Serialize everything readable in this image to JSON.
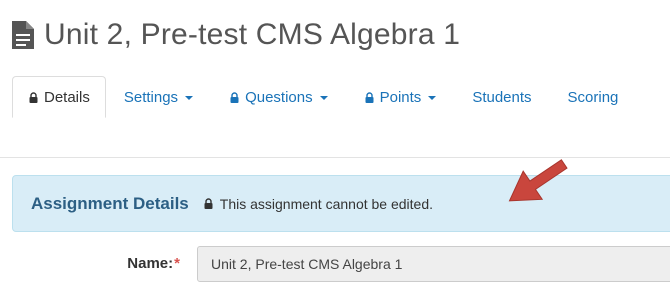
{
  "page": {
    "title": "Unit 2, Pre-test CMS Algebra 1",
    "title_icon": "document-icon"
  },
  "tabs": [
    {
      "label": "Details",
      "icon": "lock-icon",
      "active": true,
      "dropdown": false
    },
    {
      "label": "Settings",
      "icon": null,
      "active": false,
      "dropdown": true
    },
    {
      "label": "Questions",
      "icon": "lock-icon",
      "active": false,
      "dropdown": true
    },
    {
      "label": "Points",
      "icon": "lock-icon",
      "active": false,
      "dropdown": true
    },
    {
      "label": "Students",
      "icon": null,
      "active": false,
      "dropdown": false
    },
    {
      "label": "Scoring",
      "icon": null,
      "active": false,
      "dropdown": false
    }
  ],
  "info_panel": {
    "heading": "Assignment Details",
    "note": "This assignment cannot be edited.",
    "note_icon": "lock-icon"
  },
  "form": {
    "name_label": "Name:",
    "required_marker": "*",
    "name_value": "Unit 2, Pre-test CMS Algebra 1"
  },
  "colors": {
    "link": "#1a73b8",
    "panel_bg": "#d9edf7",
    "panel_heading": "#2c5f84",
    "arrow": "#c9463d",
    "required": "#d9534f"
  }
}
